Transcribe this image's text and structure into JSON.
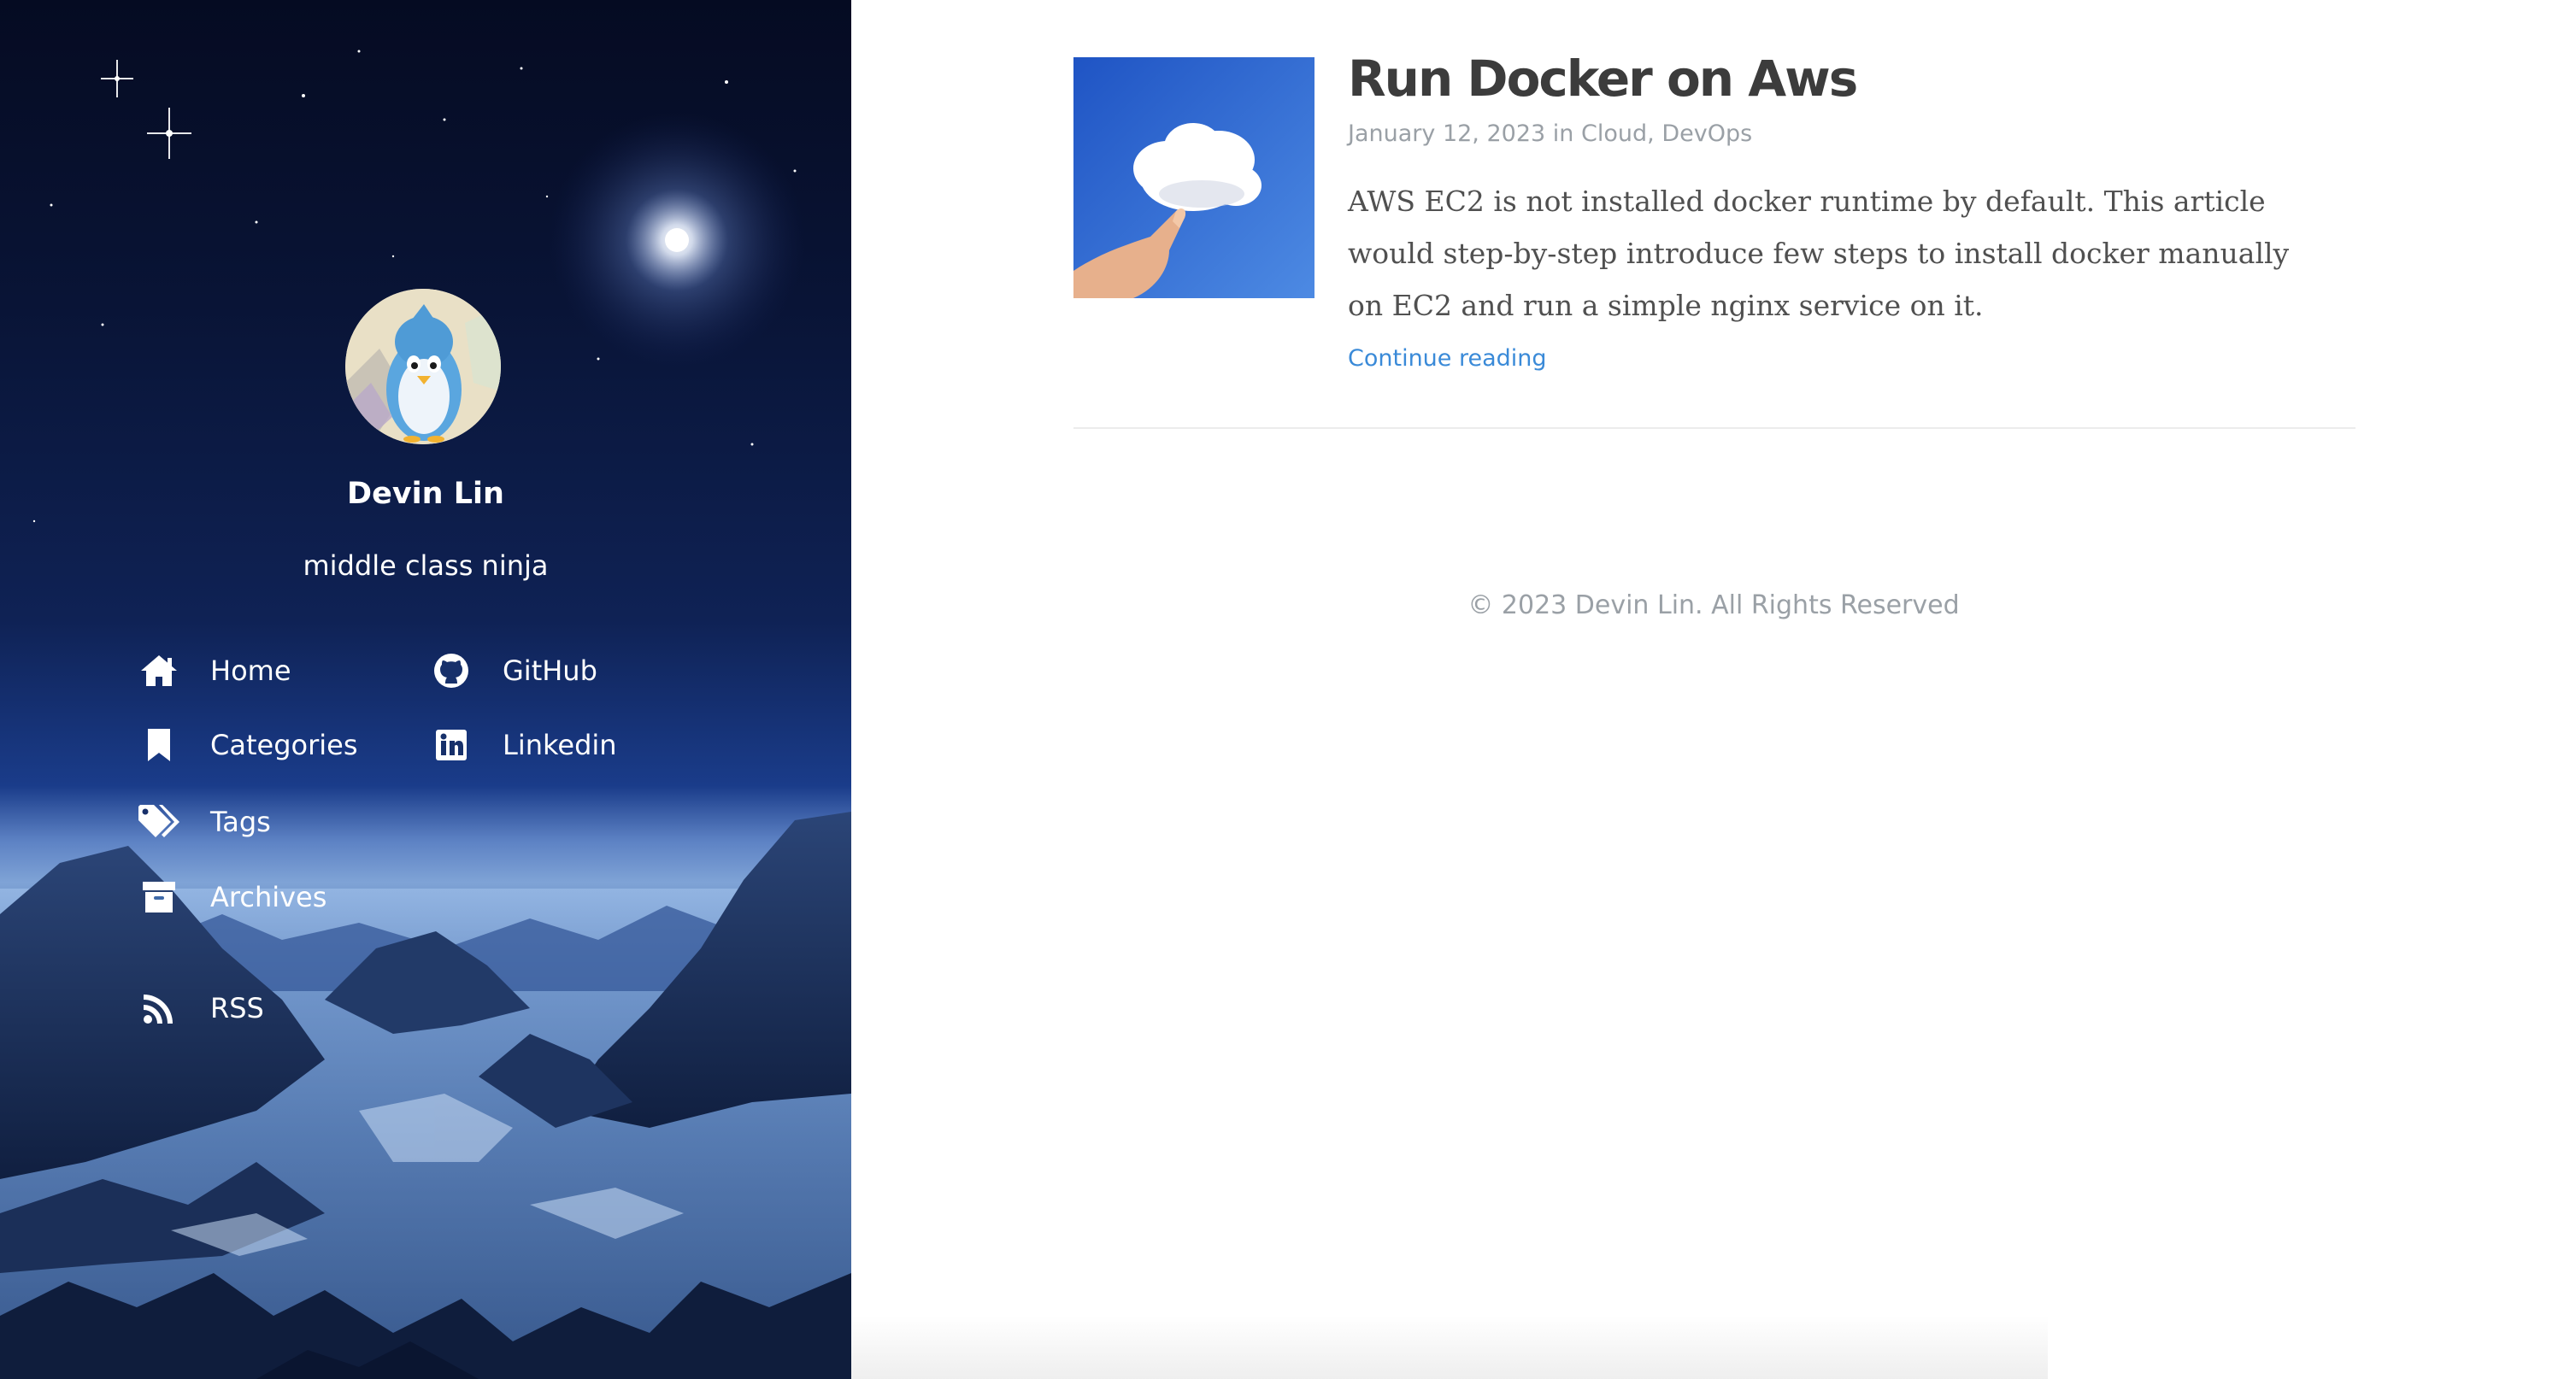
{
  "sidebar": {
    "author": {
      "name": "Devin Lin",
      "tagline": "middle class ninja"
    },
    "nav_left": [
      {
        "label": "Home",
        "icon": "home-icon"
      },
      {
        "label": "Categories",
        "icon": "bookmark-icon"
      },
      {
        "label": "Tags",
        "icon": "tags-icon"
      },
      {
        "label": "Archives",
        "icon": "archive-icon"
      },
      {
        "label": "RSS",
        "icon": "rss-icon"
      }
    ],
    "nav_right": [
      {
        "label": "GitHub",
        "icon": "github-icon"
      },
      {
        "label": "Linkedin",
        "icon": "linkedin-icon"
      }
    ]
  },
  "post": {
    "title": "Run Docker on Aws",
    "date": "January 12, 2023",
    "in": "in",
    "categories": [
      "Cloud",
      "DevOps"
    ],
    "category_separator": ",",
    "excerpt": "AWS EC2 is not installed docker runtime by default. This article would step-by-step introduce few steps to install docker manually on EC2 and run a simple nginx service on it.",
    "continue_label": "Continue reading",
    "thumbnail_icon": "cloud-hand-image"
  },
  "footer": {
    "copyright": "© 2023 Devin Lin. All Rights Reserved"
  },
  "colors": {
    "link": "#3a8ad8",
    "title": "#3c3c3c",
    "meta": "#9aa0a6",
    "sidebar_night": "#091436"
  }
}
